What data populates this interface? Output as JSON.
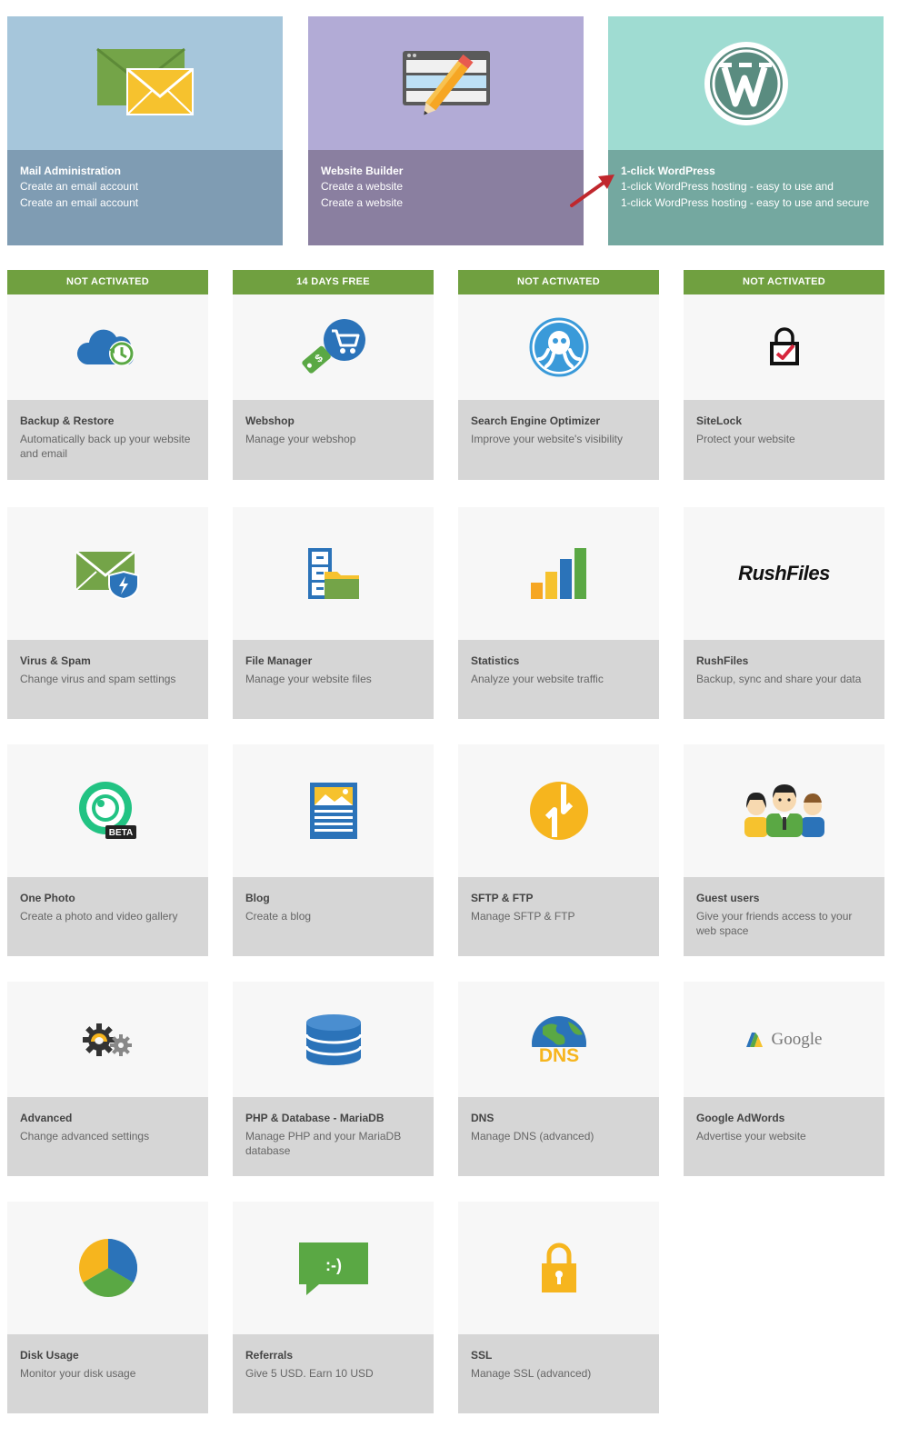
{
  "hero": {
    "mail": {
      "title": "Mail Administration",
      "line1": "Create an email account",
      "line2": "Create an email account",
      "icon": "envelope-icon"
    },
    "builder": {
      "title": "Website Builder",
      "line1": "Create a website",
      "line2": "Create a website",
      "icon": "pencil-browser-icon"
    },
    "wordpress": {
      "title": "1-click WordPress",
      "line1": "1-click WordPress hosting - easy to use and",
      "line2": "1-click WordPress hosting - easy to use and secure",
      "icon": "wordpress-icon"
    }
  },
  "tiles": [
    {
      "id": "backup",
      "banner": "NOT ACTIVATED",
      "title": "Backup & Restore",
      "desc": "Automatically back up your website and email",
      "icon": "cloud-backup-icon"
    },
    {
      "id": "webshop",
      "banner": "14 DAYS FREE",
      "title": "Webshop",
      "desc": "Manage your webshop",
      "icon": "cart-tag-icon"
    },
    {
      "id": "seo",
      "banner": "NOT ACTIVATED",
      "title": "Search Engine Optimizer",
      "desc": "Improve your website's visibility",
      "icon": "octopus-icon"
    },
    {
      "id": "sitelock",
      "banner": "NOT ACTIVATED",
      "title": "SiteLock",
      "desc": "Protect your website",
      "icon": "lock-check-icon"
    },
    {
      "id": "virus",
      "title": "Virus & Spam",
      "desc": "Change virus and spam settings",
      "icon": "envelope-shield-icon"
    },
    {
      "id": "files",
      "title": "File Manager",
      "desc": "Manage your website files",
      "icon": "file-cabinet-icon"
    },
    {
      "id": "stats",
      "title": "Statistics",
      "desc": "Analyze your website traffic",
      "icon": "bar-chart-icon"
    },
    {
      "id": "rushfiles",
      "title": "RushFiles",
      "desc": "Backup, sync and share your data",
      "icon": "rushfiles-logo",
      "logo_text": "RushFiles"
    },
    {
      "id": "photo",
      "title": "One Photo",
      "desc": "Create a photo and video gallery",
      "icon": "camera-lens-icon",
      "badge": "BETA"
    },
    {
      "id": "blog",
      "title": "Blog",
      "desc": "Create a blog",
      "icon": "blog-page-icon"
    },
    {
      "id": "sftp",
      "title": "SFTP & FTP",
      "desc": "Manage SFTP & FTP",
      "icon": "transfer-arrows-icon"
    },
    {
      "id": "guests",
      "title": "Guest users",
      "desc": "Give your friends access to your web space",
      "icon": "people-group-icon"
    },
    {
      "id": "advanced",
      "title": "Advanced",
      "desc": "Change advanced settings",
      "icon": "gears-icon"
    },
    {
      "id": "php",
      "title": "PHP & Database - MariaDB",
      "desc": "Manage PHP and your MariaDB database",
      "icon": "database-icon"
    },
    {
      "id": "dns",
      "title": "DNS",
      "desc": "Manage DNS (advanced)",
      "icon": "globe-dns-icon",
      "logo_text": "DNS"
    },
    {
      "id": "adwords",
      "title": "Google AdWords",
      "desc": "Advertise your website",
      "icon": "google-adwords-logo",
      "logo_text": "Google"
    },
    {
      "id": "disk",
      "title": "Disk Usage",
      "desc": "Monitor your disk usage",
      "icon": "pie-chart-icon"
    },
    {
      "id": "referrals",
      "title": "Referrals",
      "desc": "Give 5 USD. Earn 10 USD",
      "icon": "speech-bubble-icon",
      "logo_text": ":-)"
    },
    {
      "id": "ssl",
      "title": "SSL",
      "desc": "Manage SSL (advanced)",
      "icon": "padlock-icon"
    }
  ],
  "colors": {
    "banner_green": "#70a040",
    "mail_top": "#a6c6db",
    "builder_top": "#b2abd6",
    "wordpress_top": "#9fdcd2",
    "arrow_red": "#c0272d"
  }
}
